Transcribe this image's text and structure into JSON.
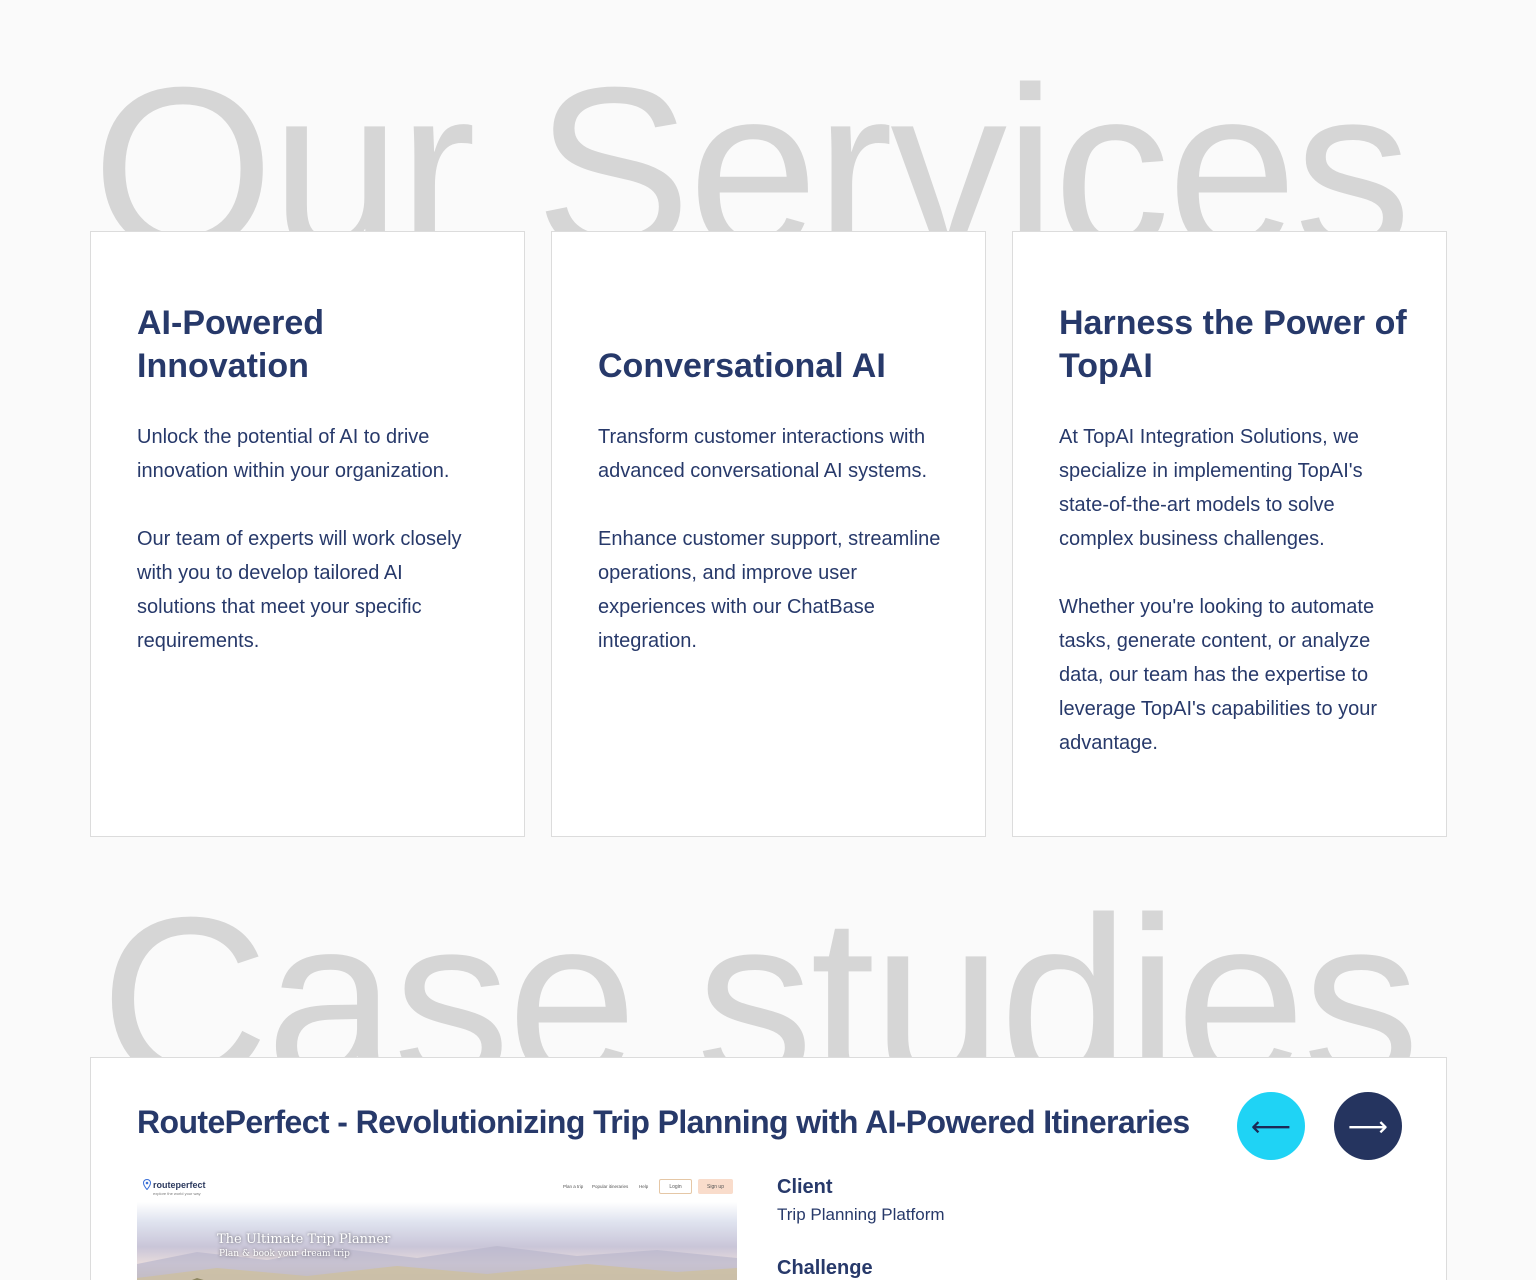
{
  "services_heading": "Our Services",
  "services": [
    {
      "title": "AI-Powered Innovation",
      "paragraphs": [
        "Unlock the potential of AI to drive innovation within your organization.",
        "Our team of experts will work closely with you to develop tailored AI solutions that meet your specific requirements."
      ]
    },
    {
      "title": "Conversational AI",
      "paragraphs": [
        "Transform customer interactions with advanced conversational AI systems.",
        "Enhance customer support, streamline operations, and improve user experiences with our ChatBase integration."
      ]
    },
    {
      "title": "Harness the Power of TopAI",
      "paragraphs": [
        "At TopAI Integration Solutions, we specialize in implementing TopAI's state-of-the-art models to solve complex business challenges.",
        "Whether you're looking to automate tasks, generate content, or analyze data, our team has the expertise to leverage TopAI's capabilities to your advantage."
      ]
    }
  ],
  "case_heading": "Case studies",
  "case_study": {
    "title": "RoutePerfect -  Revolutionizing Trip Planning with AI-Powered Itineraries",
    "prev_icon": "arrow-left-icon",
    "next_icon": "arrow-right-icon",
    "prev_glyph": "⟵",
    "next_glyph": "⟶",
    "client_label": "Client",
    "client_value": "Trip Planning Platform",
    "challenge_label": "Challenge",
    "screenshot": {
      "logo": "routeperfect",
      "logo_sub": "explore the world your way",
      "nav": [
        "Plan a trip",
        "Popular itineraries",
        "Help"
      ],
      "login": "Login",
      "signup": "Sign up",
      "hero_title": "The Ultimate Trip Planner",
      "hero_sub": "Plan & book your dream trip"
    }
  },
  "colors": {
    "navy": "#27396a",
    "watermark": "#d6d6d6",
    "prev_button": "#1fd3f5",
    "next_button": "#25345f"
  }
}
